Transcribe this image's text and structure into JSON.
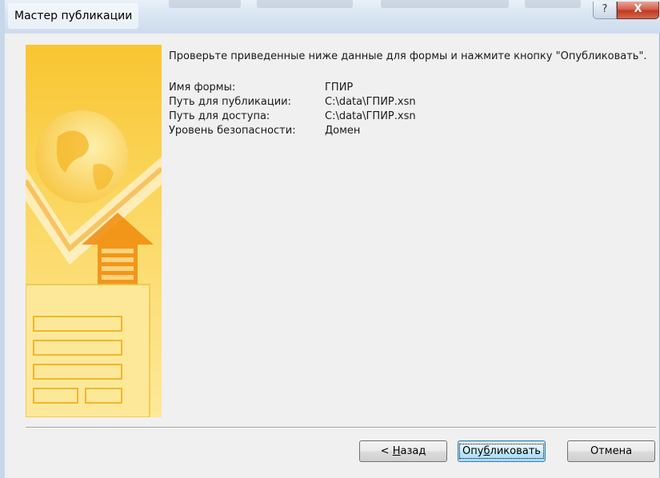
{
  "window": {
    "title": "Мастер публикации",
    "help_icon": "?",
    "close_icon": "X"
  },
  "content": {
    "instruction": "Проверьте приведенные ниже данные для формы и нажмите кнопку \"Опубликовать\".",
    "rows": [
      {
        "label": "Имя формы:",
        "value": "ГПИР"
      },
      {
        "label": "Путь для публикации:",
        "value": "C:\\data\\ГПИР.xsn"
      },
      {
        "label": "Путь для доступа:",
        "value": "C:\\data\\ГПИР.xsn"
      },
      {
        "label": "Уровень безопасности:",
        "value": "Домен"
      }
    ]
  },
  "buttons": {
    "back": {
      "pre": "< ",
      "accel": "Н",
      "post": "азад"
    },
    "publish": {
      "pre": "Опу",
      "accel": "б",
      "post": "ликовать"
    },
    "cancel": "Отмена"
  },
  "colors": {
    "banner_light": "#fde58a",
    "banner_dark": "#f5b413",
    "accent": "#3c7fb1"
  }
}
